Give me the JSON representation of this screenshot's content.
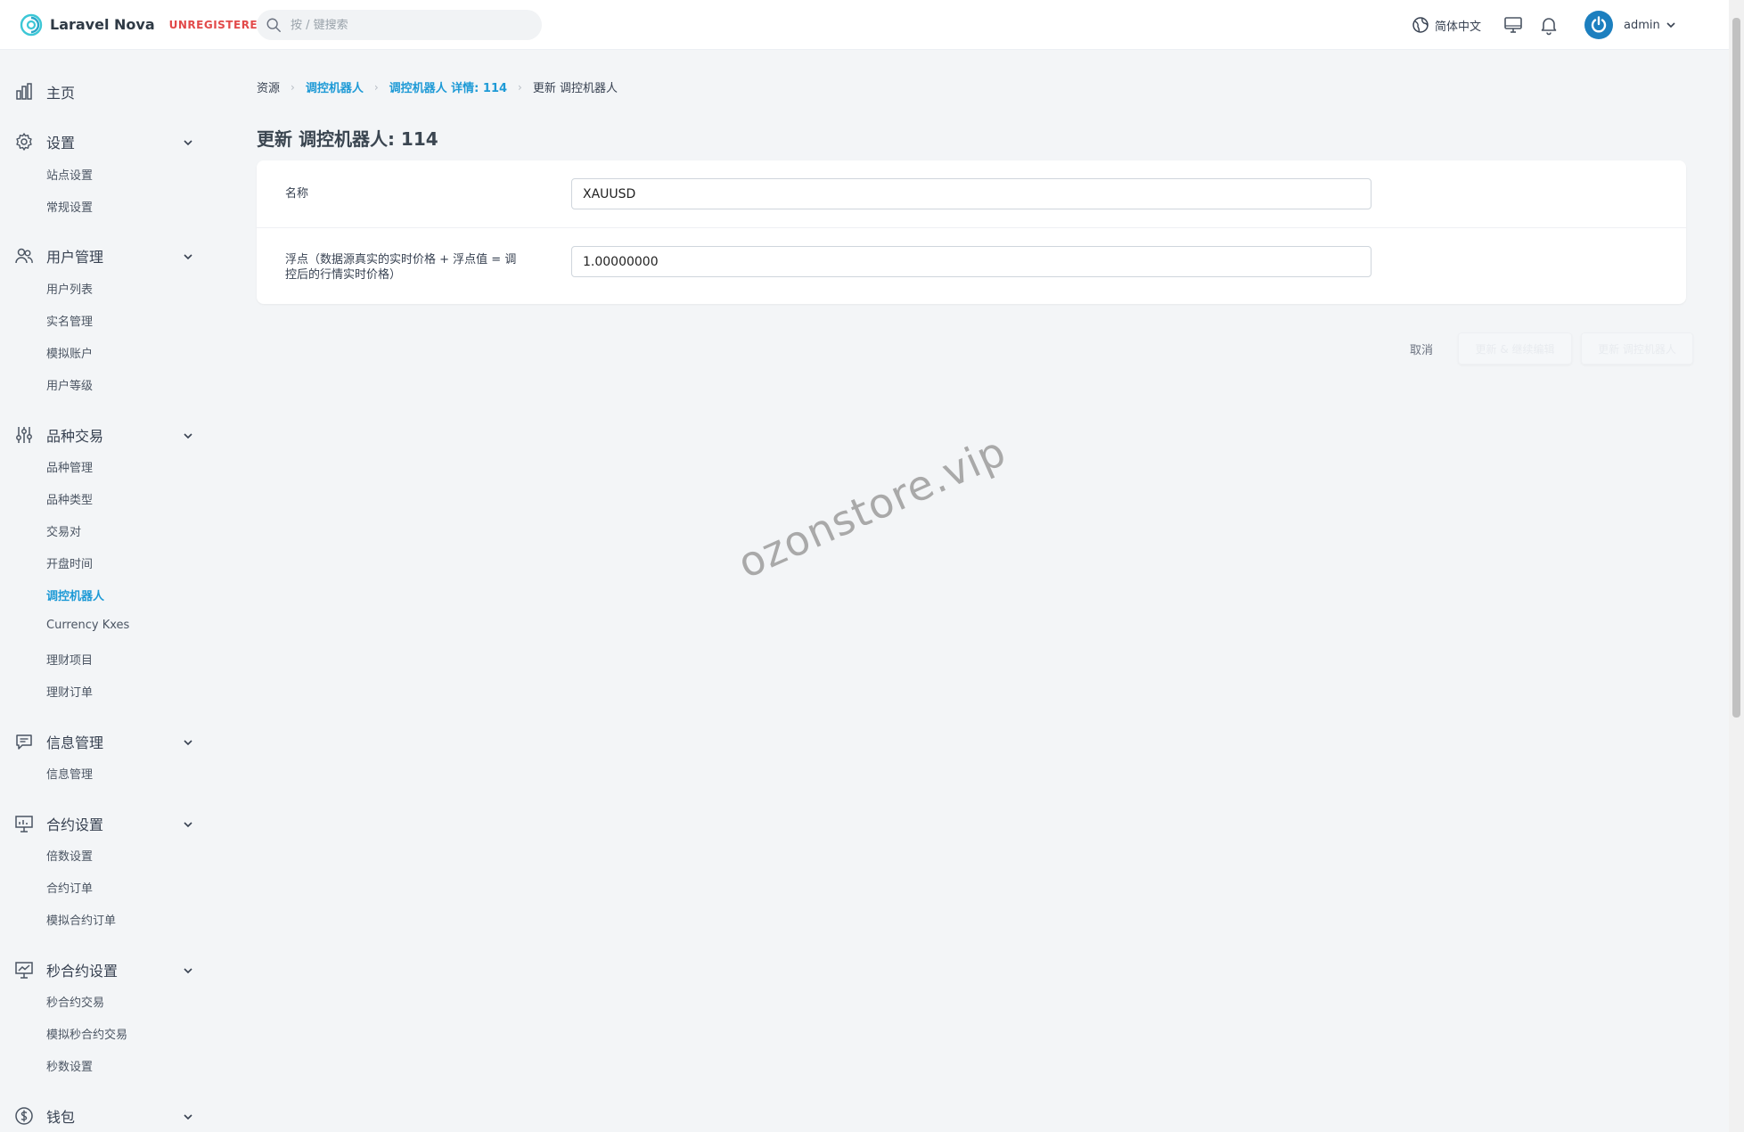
{
  "header": {
    "brand": "Laravel Nova",
    "license": "UNREGISTERED",
    "search_placeholder": "按 / 键搜索",
    "language": "简体中文",
    "user": "admin"
  },
  "sidebar": {
    "home": "主页",
    "groups": [
      {
        "label": "设置",
        "items": [
          "站点设置",
          "常规设置"
        ]
      },
      {
        "label": "用户管理",
        "items": [
          "用户列表",
          "实名管理",
          "模拟账户",
          "用户等级"
        ]
      },
      {
        "label": "品种交易",
        "items": [
          "品种管理",
          "品种类型",
          "交易对",
          "开盘时间",
          "调控机器人",
          "Currency Kxes",
          "理财项目",
          "理财订单"
        ]
      },
      {
        "label": "信息管理",
        "items": [
          "信息管理"
        ]
      },
      {
        "label": "合约设置",
        "items": [
          "倍数设置",
          "合约订单",
          "模拟合约订单"
        ]
      },
      {
        "label": "秒合约设置",
        "items": [
          "秒合约交易",
          "模拟秒合约交易",
          "秒数设置"
        ]
      },
      {
        "label": "钱包",
        "items": []
      }
    ],
    "active_item": "调控机器人"
  },
  "breadcrumb": [
    "资源",
    "调控机器人",
    "调控机器人 详情: 114",
    "更新 调控机器人"
  ],
  "page_title": "更新 调控机器人: 114",
  "form": {
    "name_label": "名称",
    "name_value": "XAUUSD",
    "float_label": "浮点（数据源真实的实时价格 + 浮点值 = 调控后的行情实时价格）",
    "float_value": "1.00000000"
  },
  "actions": {
    "cancel": "取消",
    "update_continue": "更新 & 继续编辑",
    "update": "更新 调控机器人"
  },
  "watermark": "ozonstore.vip",
  "colors": {
    "accent": "#1e9ad6",
    "unregistered": "#e24a4a",
    "background": "#f3f5f7"
  }
}
